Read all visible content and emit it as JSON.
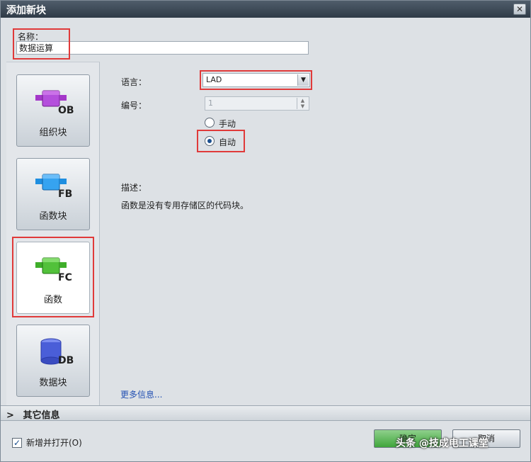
{
  "window": {
    "title": "添加新块",
    "close_glyph": "✕"
  },
  "name_field": {
    "label": "名称：",
    "value": "数据运算"
  },
  "block_types": [
    {
      "code": "OB",
      "label": "组织块",
      "color": "#a438c9"
    },
    {
      "code": "FB",
      "label": "函数块",
      "color": "#1e8ee0"
    },
    {
      "code": "FC",
      "label": "函数",
      "color": "#3fae2a",
      "selected": true
    },
    {
      "code": "DB",
      "label": "数据块",
      "color": "#4a5ed8"
    }
  ],
  "form": {
    "language_label": "语言：",
    "language_value": "LAD",
    "number_label": "编号：",
    "number_value": "1",
    "manual_label": "手动",
    "auto_label": "自动",
    "selected_mode": "自动"
  },
  "description": {
    "label": "描述：",
    "text": "函数是没有专用存储区的代码块。"
  },
  "more_info": "更多信息...",
  "other_info": {
    "chevron": ">",
    "label": "其它信息"
  },
  "footer": {
    "open_label": "新增并打开(O)",
    "open_checked": true,
    "ok_label": "确定",
    "cancel_label": "取消"
  },
  "watermark": "头条 @技成电工课堂"
}
